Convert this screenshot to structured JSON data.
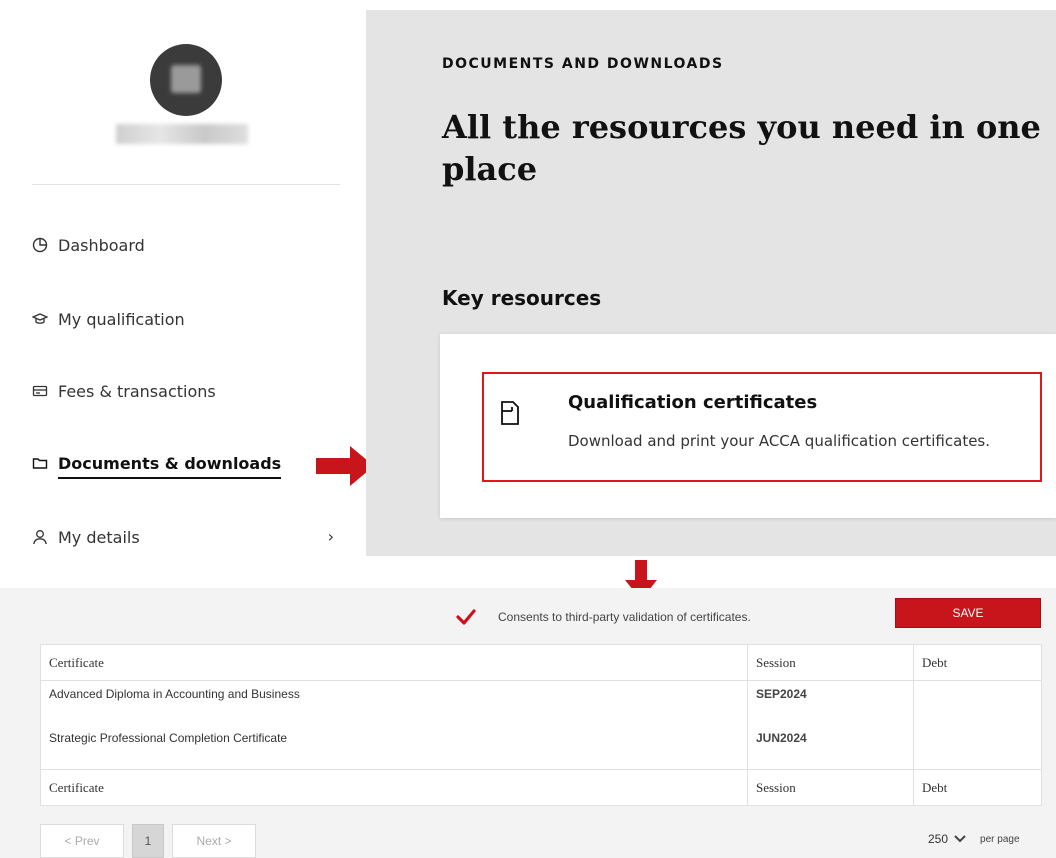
{
  "nav": {
    "items": [
      {
        "label": "Dashboard",
        "icon": "pie-chart-icon"
      },
      {
        "label": "My qualification",
        "icon": "graduation-cap-icon"
      },
      {
        "label": "Fees & transactions",
        "icon": "card-icon"
      },
      {
        "label": "Documents & downloads",
        "icon": "folder-icon",
        "active": true
      },
      {
        "label": "My details",
        "icon": "person-icon",
        "chevron": "›"
      }
    ]
  },
  "main": {
    "eyebrow": "DOCUMENTS AND DOWNLOADS",
    "headline": "All the resources you need in one place",
    "section_title": "Key resources",
    "card": {
      "title": "Qualification certificates",
      "description": "Download and print your ACCA qualification certificates."
    }
  },
  "consent": {
    "label": "Consents to third-party validation of certificates.",
    "checked": true
  },
  "save_label": "SAVE",
  "table": {
    "headers": [
      "Certificate",
      "Session",
      "Debt"
    ],
    "rows": [
      {
        "certificate": "Advanced Diploma in Accounting and Business",
        "session": "SEP2024",
        "debt": ""
      },
      {
        "certificate": "Strategic Professional Completion Certificate",
        "session": "JUN2024",
        "debt": ""
      }
    ],
    "footer": [
      "Certificate",
      "Session",
      "Debt"
    ]
  },
  "pager": {
    "prev": "< Prev",
    "page": "1",
    "next": "Next >",
    "per_page_value": "250",
    "per_page_label": "per page"
  },
  "colors": {
    "accent": "#c8151b",
    "card_border": "#e0181b",
    "panel_bg": "#e4e4e4"
  }
}
